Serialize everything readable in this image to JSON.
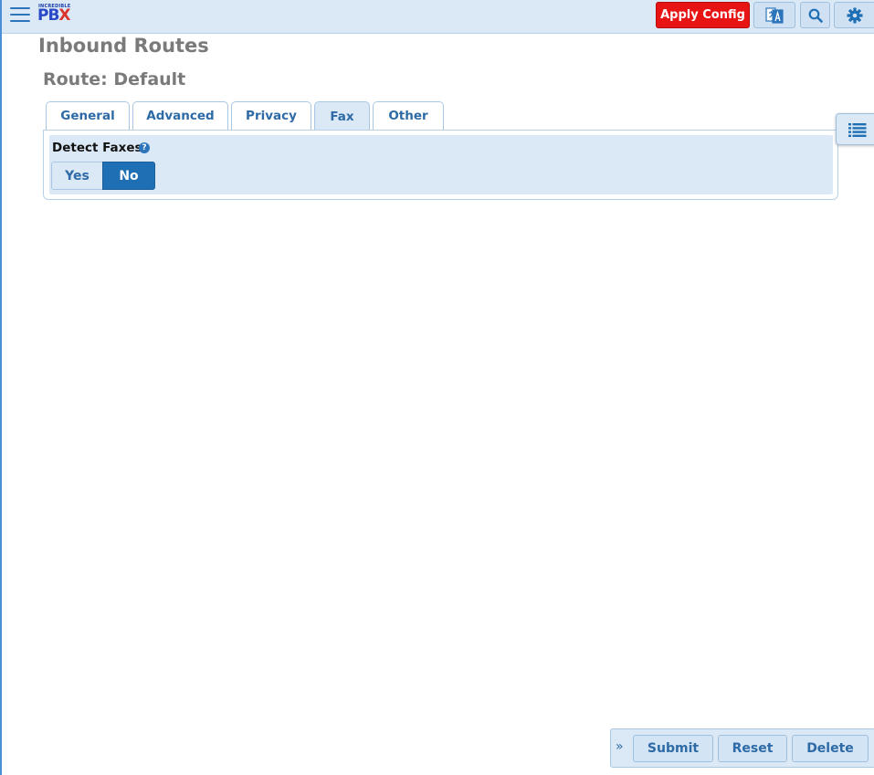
{
  "header": {
    "logo_small": "INCREDIBLE",
    "logo_main": "PB",
    "logo_x": "X",
    "apply_config_label": "Apply Config",
    "colors": {
      "apply": "#e81313",
      "bar": "#dbe9f6",
      "accent": "#2d75bb"
    }
  },
  "page": {
    "title": "Inbound Routes",
    "route_title": "Route: Default"
  },
  "tabs": [
    {
      "label": "General",
      "active": false
    },
    {
      "label": "Advanced",
      "active": false
    },
    {
      "label": "Privacy",
      "active": false
    },
    {
      "label": "Fax",
      "active": true
    },
    {
      "label": "Other",
      "active": false
    }
  ],
  "fax": {
    "detect_label": "Detect Faxes",
    "help_glyph": "?",
    "yes_label": "Yes",
    "no_label": "No",
    "selected": "No"
  },
  "actions": {
    "collapse_glyph": "»",
    "submit_label": "Submit",
    "reset_label": "Reset",
    "delete_label": "Delete"
  },
  "icons": {
    "menu": "hamburger-menu-icon",
    "translate": "translate-icon",
    "search": "search-icon",
    "settings": "gear-icon",
    "list": "list-icon"
  }
}
